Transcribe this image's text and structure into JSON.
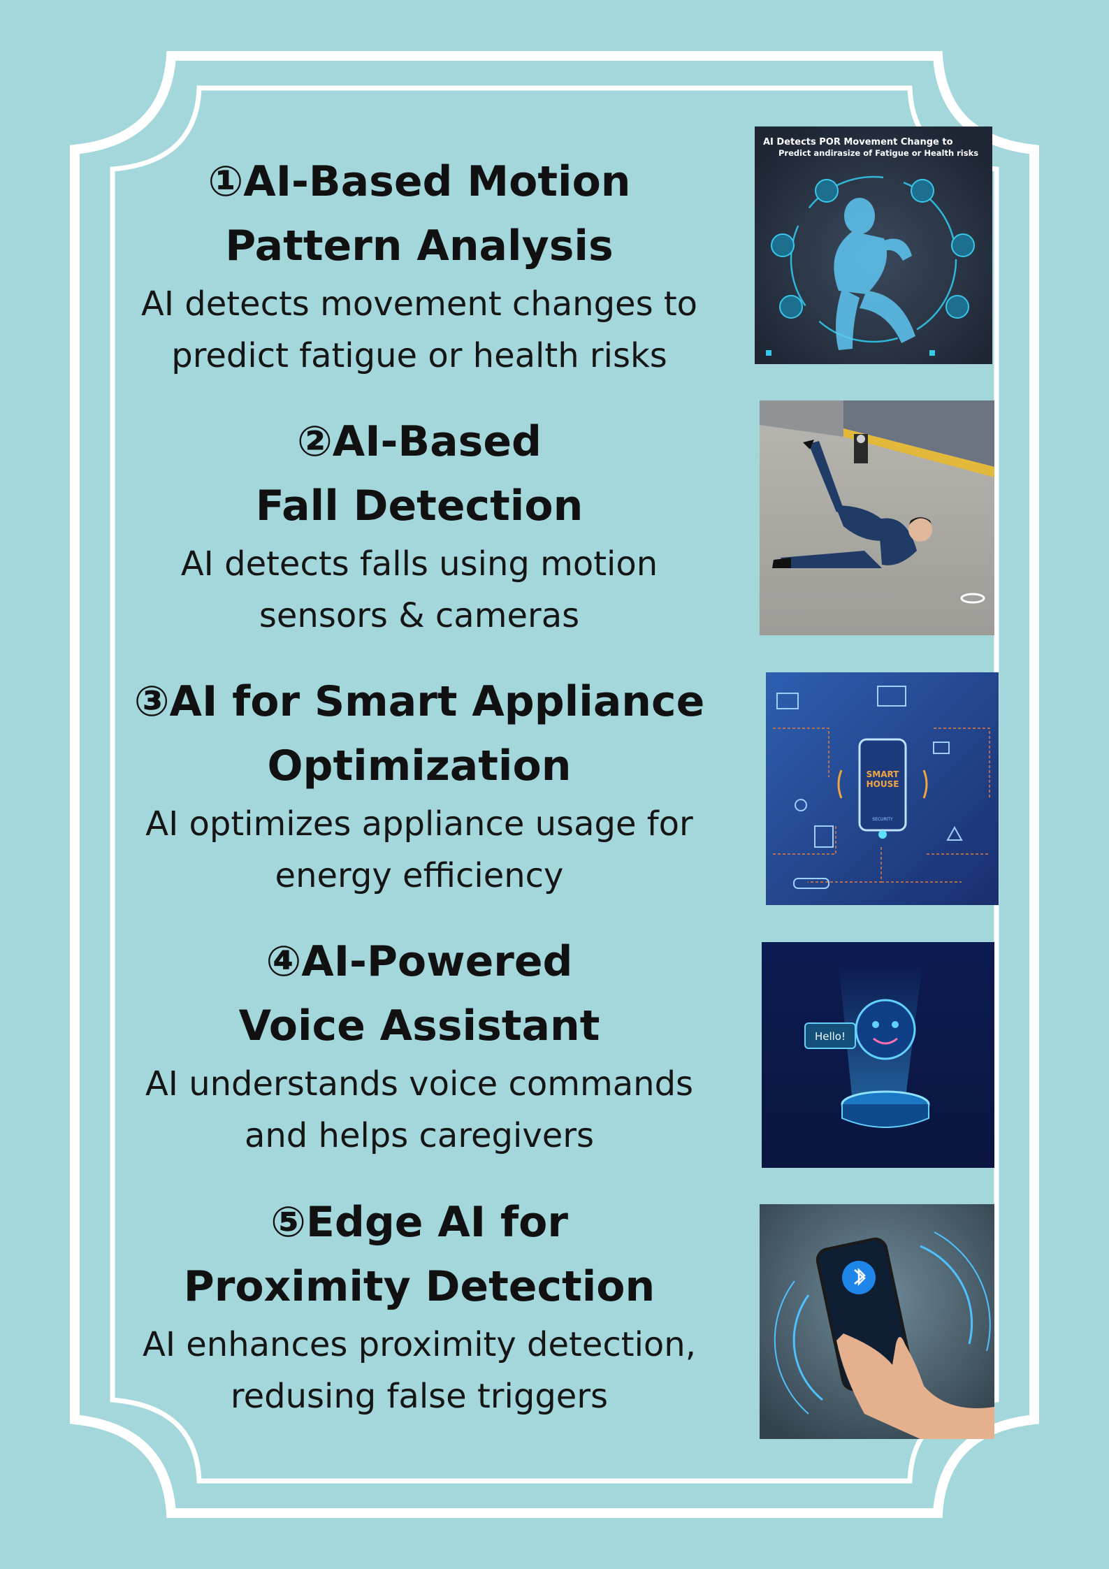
{
  "colors": {
    "background": "#a3d7db",
    "frame": "#ffffff",
    "text": "#111111"
  },
  "sections": [
    {
      "title_lines": [
        "①AI-Based Motion",
        "Pattern Analysis"
      ],
      "desc_lines": [
        "AI detects movement changes to",
        "predict fatigue or health risks"
      ],
      "image": {
        "icon": "motion-analysis-figure",
        "title_lines": [
          "AI Detects POR Movement Change to",
          "Predict andirasize of Fatigue or Health risks"
        ]
      }
    },
    {
      "title_lines": [
        "②AI-Based",
        "Fall Detection"
      ],
      "desc_lines": [
        "AI detects falls using motion",
        "sensors & cameras"
      ],
      "image": {
        "icon": "falling-person-photo"
      }
    },
    {
      "title_lines": [
        "③AI for Smart Appliance",
        "Optimization"
      ],
      "desc_lines": [
        "AI optimizes appliance usage for",
        "energy efficiency"
      ],
      "image": {
        "icon": "smart-house-phone",
        "phone_text": [
          "SMART",
          "HOUSE"
        ],
        "phone_subtext": "SECURITY"
      }
    },
    {
      "title_lines": [
        "④AI-Powered",
        "Voice Assistant"
      ],
      "desc_lines": [
        "AI understands voice commands",
        "and helps caregivers"
      ],
      "image": {
        "icon": "voice-assistant-hologram",
        "bubble_text": "Hello!"
      }
    },
    {
      "title_lines": [
        "⑤Edge AI for",
        "Proximity Detection"
      ],
      "desc_lines": [
        "AI enhances proximity detection,",
        "redusing false triggers"
      ],
      "image": {
        "icon": "bluetooth-phone-hand"
      }
    }
  ]
}
